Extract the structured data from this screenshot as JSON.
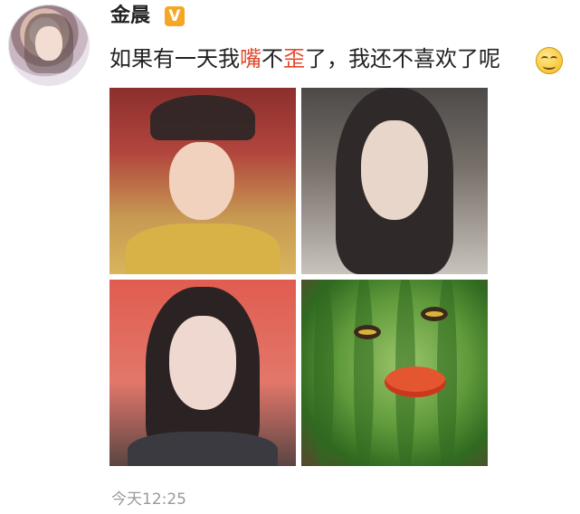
{
  "user": {
    "name": "金晨",
    "badge": "V"
  },
  "post": {
    "text_before": "如果有一天我",
    "text_hl1": "嘴",
    "text_mid": "不",
    "text_hl2": "歪",
    "text_after": "了，我还不喜欢了呢",
    "emoji": "grin-emoji",
    "images": [
      {
        "name": "costume-child-photo"
      },
      {
        "name": "funny-face-photo"
      },
      {
        "name": "stage-makeup-photo"
      },
      {
        "name": "watermelon-face-photo"
      }
    ],
    "timestamp": "今天12:25"
  },
  "colors": {
    "highlight": "#e0492c",
    "badge": "#f5a623",
    "timestamp": "#9a9a9a"
  }
}
